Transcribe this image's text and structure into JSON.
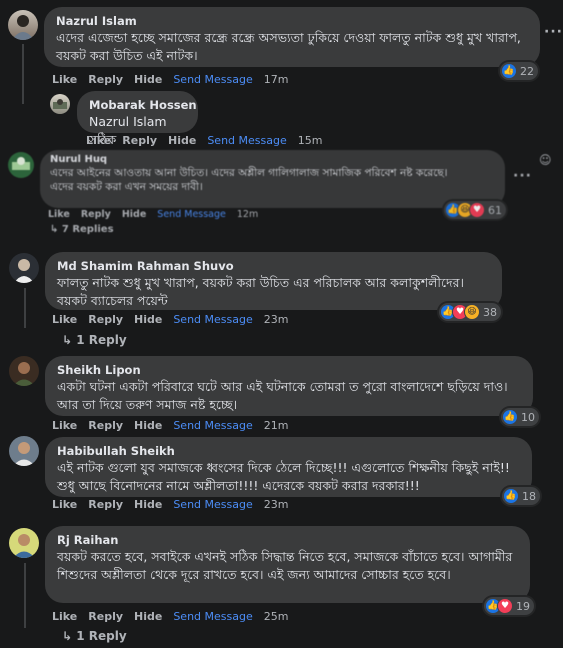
{
  "actions": {
    "like": "Like",
    "reply": "Reply",
    "hide": "Hide",
    "send": "Send Message"
  },
  "comments": [
    {
      "name": "Nazrul Islam",
      "text": "এদের এজেন্ডা হচ্ছে সমাজের রন্ধ্রে রন্ধ্রে অসভ্যতা ঢুকিয়ে দেওয়া ফালতু নাটক শুধু মুখ খারাপ, বয়কট করা উচিত এই নাটক।",
      "time": "17m",
      "reactions": "22"
    },
    {
      "name": "Mobarak Hossen",
      "text": "Nazrul Islam সঠিক",
      "time": "15m"
    },
    {
      "name": "Nurul Huq",
      "text": "এদের আইনের আওতায় আনা উচিত। এদের অশ্লীল গালিগালাজ সামাজিক পরিবেশ নষ্ট করেছে।\nএদের বয়কট করা এখন সময়ের দাবী।",
      "time": "12m",
      "reactions": "61",
      "replies": "7 Replies"
    },
    {
      "name": "Md Shamim Rahman Shuvo",
      "text": "ফালতু নাটক শুধু মুখ খারাপ, বয়কট করা উচিত এর পরিচালক আর কলাকুশলীদের।\nবয়কট ব্যাচেলর পয়েন্ট",
      "time": "23m",
      "reactions": "38",
      "replies": "1 Reply"
    },
    {
      "name": "Sheikh Lipon",
      "text": "একটা ঘটনা একটা পরিবারে ঘটে আর এই ঘটনাকে তোমরা ত পুরো বাংলাদেশে ছড়িয়ে দাও। আর তা দিয়ে তরুণ সমাজ নষ্ট হচ্ছে।",
      "time": "21m",
      "reactions": "10"
    },
    {
      "name": "Habibullah Sheikh",
      "text": "এই নাটক গুলো যুব সমাজকে ধ্বংসের দিকে ঠেলে দিচ্ছে!!! এগুলোতে শিক্ষনীয় কিছুই নাই!! শুধু আছে বিনোদনের নামে অশ্লীলতা!!!! এদেরকে বয়কট করার দরকার!!!",
      "time": "23m",
      "reactions": "18"
    },
    {
      "name": "Rj Raihan",
      "text": "বয়কট করতে হবে, সবাইকে এখনই সঠিক সিদ্ধান্ত নিতে হবে, সমাজকে বাঁচাতে হবে। আগামীর শিশুদের অশ্লীলতা থেকে দূরে রাখতে হবে। এই জন্য আমাদের সোচ্চার হতে হবে।",
      "time": "25m",
      "reactions": "19",
      "replies": "1 Reply"
    }
  ],
  "colors": {
    "background": "#18191a",
    "bubble": "#3a3b3c",
    "link": "#4c8df6",
    "like": "#1b74e4",
    "love": "#f33e58",
    "haha": "#f7b125"
  },
  "icons": [
    "more-dots-icon",
    "like-reaction-icon",
    "love-reaction-icon",
    "haha-reaction-icon",
    "reply-arrow-icon",
    "sticker-icon"
  ]
}
